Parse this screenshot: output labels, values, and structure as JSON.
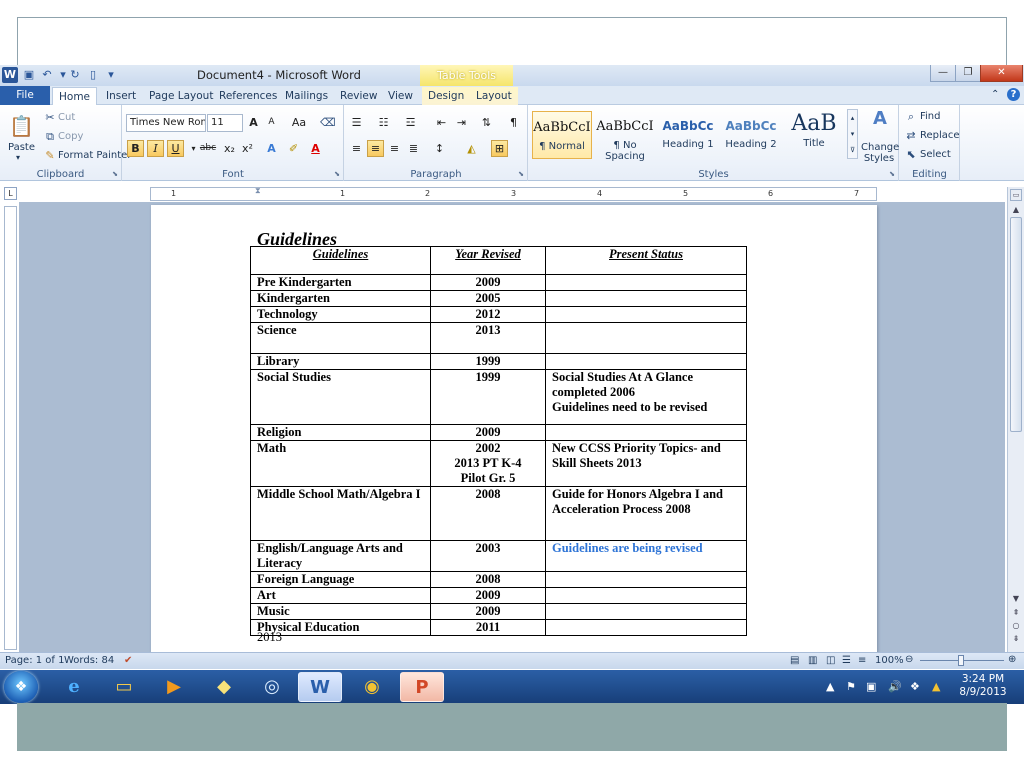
{
  "window": {
    "title": "Document4 - Microsoft Word",
    "contextual_header": "Table Tools",
    "app_icon_letter": "W",
    "buttons": {
      "minimize": "—",
      "restore": "❐",
      "close": "✕"
    }
  },
  "tabs": [
    "File",
    "Home",
    "Insert",
    "Page Layout",
    "References",
    "Mailings",
    "Review",
    "View",
    "Design",
    "Layout"
  ],
  "ribbon": {
    "clipboard": {
      "paste": "Paste",
      "cut": "Cut",
      "copy": "Copy",
      "format_painter": "Format Painter",
      "label": "Clipboard"
    },
    "font": {
      "font_name": "Times New Roma",
      "font_size": "11",
      "label": "Font",
      "bold": "B",
      "italic": "I",
      "underline": "U",
      "strike": "abc",
      "sub": "x₂",
      "sup": "x²",
      "grow": "A",
      "shrink": "A",
      "case": "Aa"
    },
    "paragraph": {
      "label": "Paragraph"
    },
    "styles": {
      "label": "Styles",
      "items": [
        {
          "sample": "AaBbCcI",
          "name": "¶ Normal"
        },
        {
          "sample": "AaBbCcI",
          "name": "¶ No Spacing"
        },
        {
          "sample": "AaBbCc",
          "name": "Heading 1"
        },
        {
          "sample": "AaBbCc",
          "name": "Heading 2"
        },
        {
          "sample": "AaB",
          "name": "Title"
        }
      ],
      "change_styles": "Change Styles"
    },
    "editing": {
      "find": "Find",
      "replace": "Replace",
      "select": "Select",
      "label": "Editing"
    }
  },
  "ruler": {
    "corner": "L",
    "numbers": [
      "1",
      "1",
      "2",
      "3",
      "4",
      "5",
      "6",
      "7"
    ]
  },
  "document": {
    "heading": "Guidelines",
    "table": {
      "headers": [
        "Guidelines",
        "Year Revised",
        "Present Status"
      ],
      "rows": [
        {
          "name": "Pre Kindergarten",
          "year": "2009",
          "status": ""
        },
        {
          "name": "Kindergarten",
          "year": "2005",
          "status": ""
        },
        {
          "name": "Technology",
          "year": "2012",
          "status": ""
        },
        {
          "name": "Science",
          "year": "2013",
          "status": ""
        },
        {
          "name": "Library",
          "year": "1999",
          "status": ""
        },
        {
          "name": "Social Studies",
          "year": "1999",
          "status": "Social Studies At A Glance completed 2006\nGuidelines need to be revised"
        },
        {
          "name": "Religion",
          "year": "2009",
          "status": ""
        },
        {
          "name": "Math",
          "year": "2002\n2013 PT K-4\nPilot Gr. 5",
          "status": "New CCSS Priority Topics- and Skill Sheets 2013"
        },
        {
          "name": "Middle School Math/Algebra I",
          "year": "2008",
          "status": "Guide for Honors Algebra I and Acceleration Process 2008"
        },
        {
          "name": "English/Language Arts and Literacy",
          "year": "2003",
          "status": "Guidelines are being revised"
        },
        {
          "name": "Foreign Language",
          "year": "2008",
          "status": ""
        },
        {
          "name": "Art",
          "year": "2009",
          "status": ""
        },
        {
          "name": "Music",
          "year": "2009",
          "status": ""
        },
        {
          "name": "Physical Education",
          "year": "2011",
          "status": ""
        }
      ]
    },
    "after_text": "2013"
  },
  "status_bar": {
    "page": "Page: 1 of 1",
    "words": "Words: 84",
    "zoom": "100%",
    "zoom_level_percent": 100
  },
  "taskbar": {
    "clock_time": "3:24 PM",
    "clock_date": "8/9/2013",
    "apps": [
      "internet-explorer",
      "file-explorer",
      "media-player",
      "sticky-notes",
      "network",
      "word",
      "chrome",
      "powerpoint"
    ]
  },
  "colors": {
    "file_tab": "#2a5fab",
    "status_blue_text": "#2e74d6",
    "taskbar": "#1f4d8c",
    "close_button": "#c2381a"
  }
}
